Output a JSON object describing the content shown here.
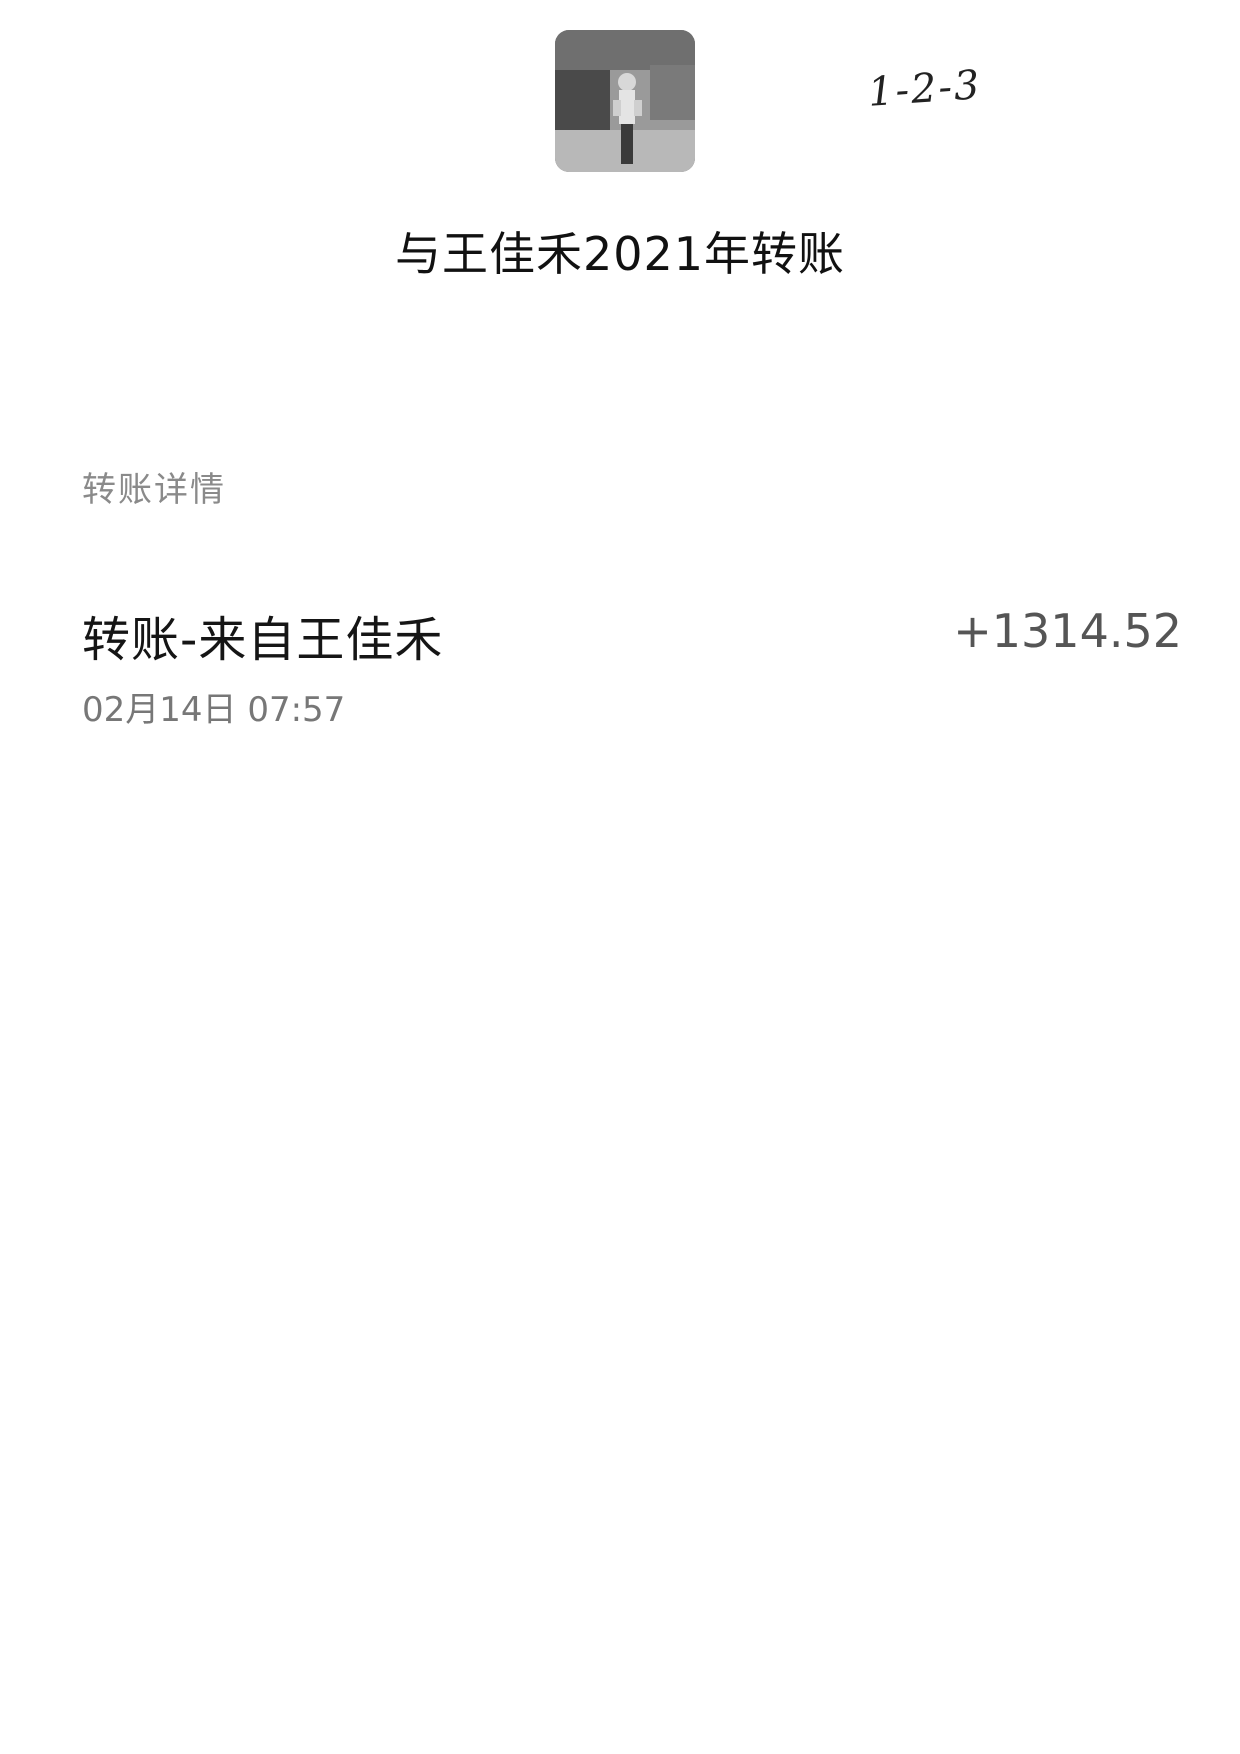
{
  "header": {
    "avatar_icon": "profile-photo",
    "title": "与王佳禾2021年转账"
  },
  "annotation": {
    "handwritten_note": "1-2-3"
  },
  "section": {
    "label": "转账详情"
  },
  "transactions": [
    {
      "title": "转账-来自王佳禾",
      "amount": "+1314.52",
      "time": "02月14日 07:57"
    }
  ]
}
